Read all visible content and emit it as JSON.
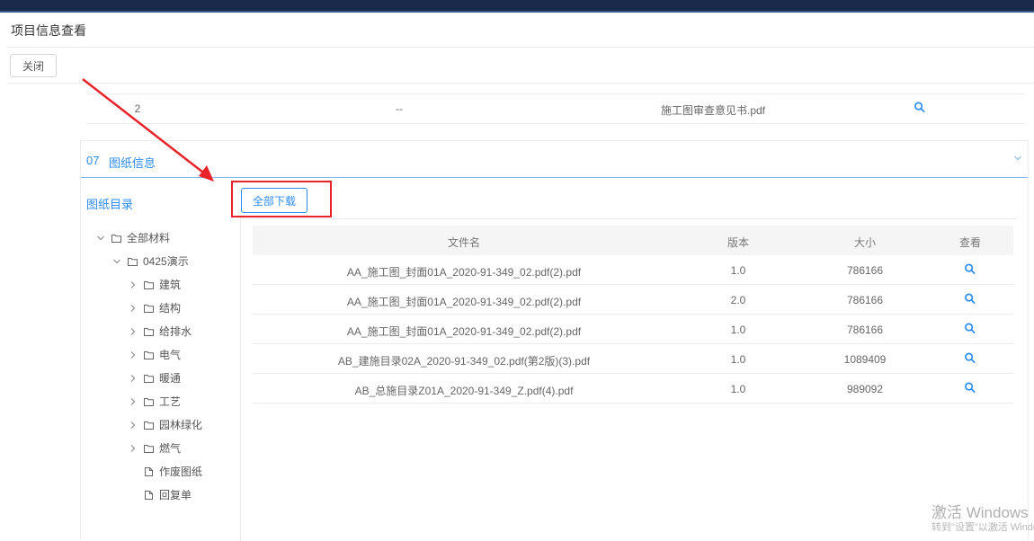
{
  "header": {
    "title": "项目信息查看",
    "close_label": "关闭"
  },
  "prev_row": {
    "index": "2",
    "dash": "--",
    "file": "施工图审查意见书.pdf"
  },
  "section": {
    "number": "07",
    "title": "图纸信息",
    "tree_title": "图纸目录",
    "download_all_label": "全部下载"
  },
  "tree": {
    "root": "全部材料",
    "project": "0425演示",
    "folders": [
      "建筑",
      "结构",
      "给排水",
      "电气",
      "暖通",
      "工艺",
      "园林绿化",
      "燃气"
    ],
    "files": [
      "作废图纸",
      "回复单"
    ]
  },
  "table": {
    "headers": {
      "filename": "文件名",
      "version": "版本",
      "size": "大小",
      "view": "查看"
    },
    "rows": [
      {
        "filename": "AA_施工图_封面01A_2020-91-349_02.pdf(2).pdf",
        "version": "1.0",
        "size": "786166"
      },
      {
        "filename": "AA_施工图_封面01A_2020-91-349_02.pdf(2).pdf",
        "version": "2.0",
        "size": "786166"
      },
      {
        "filename": "AA_施工图_封面01A_2020-91-349_02.pdf(2).pdf",
        "version": "1.0",
        "size": "786166"
      },
      {
        "filename": "AB_建施目录02A_2020-91-349_02.pdf(第2版)(3).pdf",
        "version": "1.0",
        "size": "1089409"
      },
      {
        "filename": "AB_总施目录Z01A_2020-91-349_Z.pdf(4).pdf",
        "version": "1.0",
        "size": "989092"
      }
    ]
  },
  "watermark": {
    "line1": "激活 Windows",
    "line2": "转到\"设置\"以激活 Windows。"
  },
  "colors": {
    "accent": "#2d8cf0",
    "annotation": "#e8232a",
    "topbar": "#1b2a4a"
  },
  "icons": [
    "search-icon",
    "chevron-down-icon",
    "chevron-right-icon",
    "folder-icon",
    "file-icon"
  ]
}
